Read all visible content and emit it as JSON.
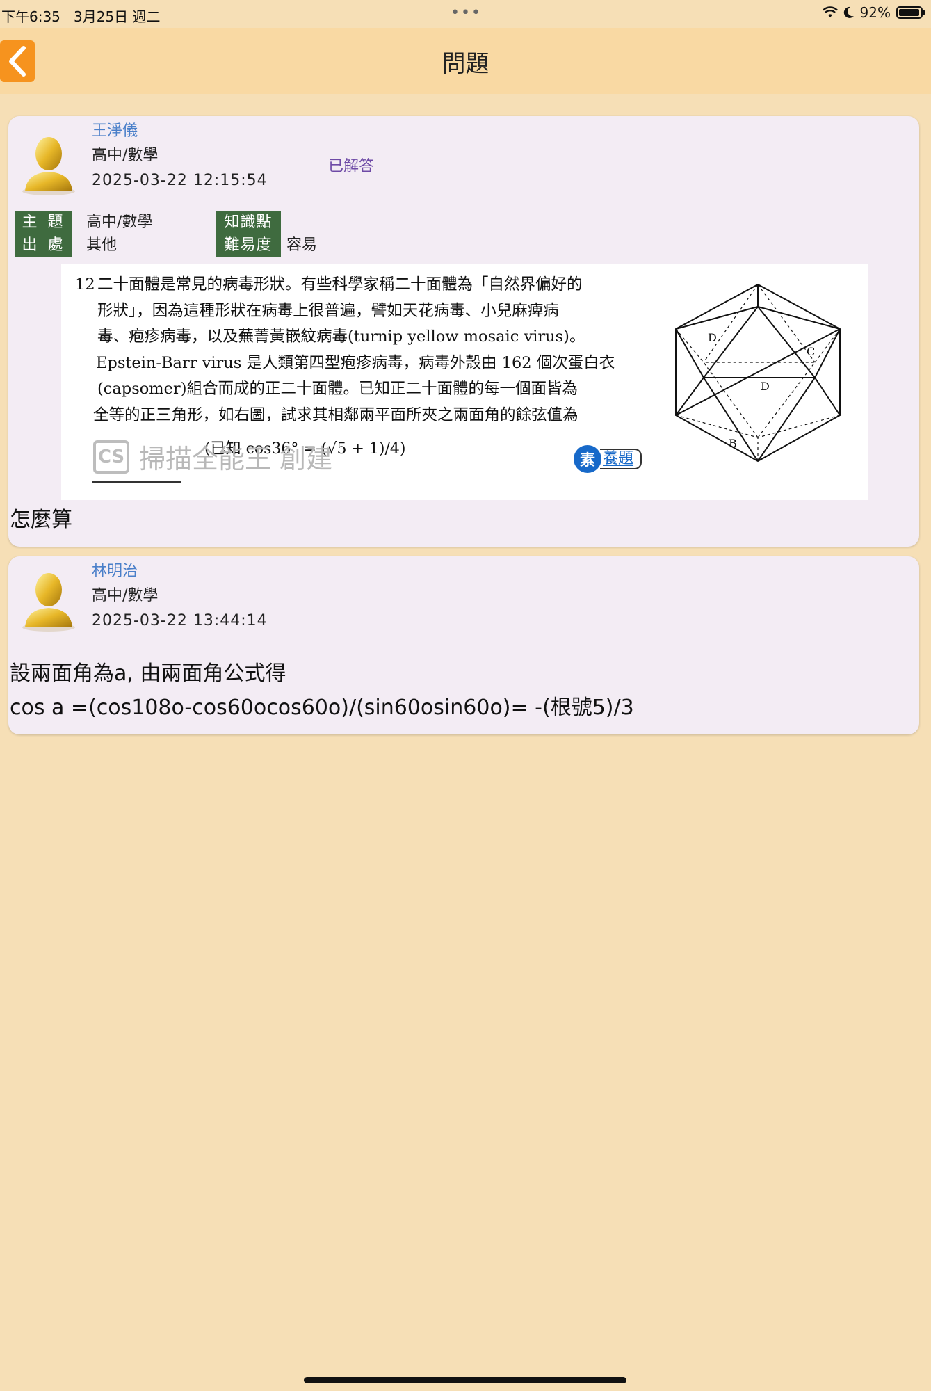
{
  "status_bar": {
    "time": "下午6:35",
    "date": "3月25日 週二",
    "battery": "92%"
  },
  "nav": {
    "title": "問題"
  },
  "question": {
    "username": "王淨儀",
    "subject": "高中/數學",
    "datetime": "2025-03-22 12:15:54",
    "status": "已解答",
    "meta": {
      "topic_label": "主 題",
      "topic_value": "高中/數學",
      "source_label": "出 處",
      "source_value": "其他",
      "knowledge_label": "知識點",
      "knowledge_value": "",
      "difficulty_label": "難易度",
      "difficulty_value": "容易"
    },
    "problem_image": {
      "number": "12",
      "lines": [
        "二十面體是常見的病毒形狀。有些科學家稱二十面體為「自然界偏好的",
        "形狀」，因為這種形狀在病毒上很普遍，譬如天花病毒、小兒麻痺病",
        "毒、疱疹病毒，以及蕪菁黃嵌紋病毒(turnip yellow mosaic virus)。",
        "Epstein-Barr virus 是人類第四型疱疹病毒，病毒外殼由 162 個次蛋白衣",
        "(capsomer)組合而成的正二十面體。已知正二十面體的每一個面皆為",
        "全等的正三角形，如右圖，試求其相鄰兩平面所夾之兩面角的餘弦值為"
      ],
      "formula": "(已知 cos36° = (√5 + 1)/4)",
      "watermark": "掃描全能王 創建",
      "watermark_logo": "CS",
      "tag_icon": "素",
      "tag_label": "養題"
    },
    "text": "怎麼算"
  },
  "answer": {
    "username": "林明治",
    "subject": "高中/數學",
    "datetime": "2025-03-22 13:44:14",
    "lines": [
      "設兩面角為a, 由兩面角公式得",
      "cos a =(cos108o-cos60ocos60o)/(sin60osin60o)= -(根號5)/3"
    ]
  },
  "colors": {
    "background": "#f6dfb6",
    "nav": "#f9d9a3",
    "back_button": "#f6931e",
    "card": "#f3ecf4",
    "meta_label": "#3f6b3f",
    "username": "#4a7fc9",
    "answered": "#6e4aa6"
  },
  "icons": {
    "back": "chevron-left-icon",
    "avatar": "user-avatar-icon",
    "wifi": "wifi-icon",
    "moon": "moon-icon",
    "battery": "battery-icon"
  }
}
